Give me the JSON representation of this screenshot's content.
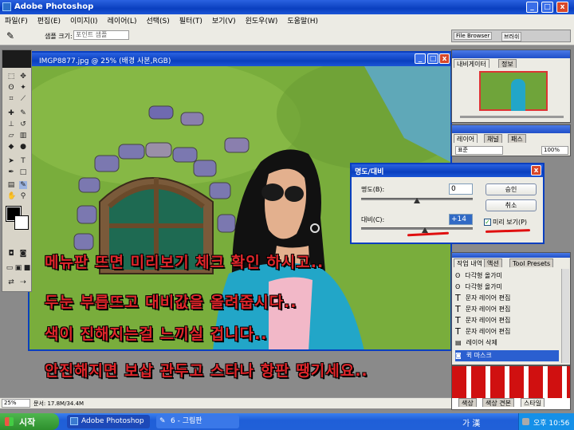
{
  "app": {
    "title": "Adobe Photoshop"
  },
  "menu": [
    "파일(F)",
    "편집(E)",
    "이미지(I)",
    "레이어(L)",
    "선택(S)",
    "필터(T)",
    "보기(V)",
    "윈도우(W)",
    "도움말(H)"
  ],
  "options_bar": {
    "label": "샘플 크기:",
    "value": "포인트 샘플"
  },
  "palette_well": {
    "tabs": [
      "File Browser",
      "브러쉬"
    ]
  },
  "document": {
    "title": "IMGP8877.jpg @ 25% (배경 사본,RGB)"
  },
  "navigator": {
    "tabs": [
      "내비게이터",
      "정보"
    ]
  },
  "layers": {
    "tabs": [
      "레이어",
      "채널",
      "패스"
    ],
    "mode": "표준",
    "opacity": "100%",
    "fill": "100%"
  },
  "history": {
    "tabs": [
      "작업 내역",
      "액션",
      "Tool Presets"
    ],
    "items": [
      "다각형 올가미",
      "다각형 올가미",
      "문자 레이어 편집",
      "문자 레이어 편집",
      "문자 레이어 편집",
      "문자 레이어 편집",
      "레이어 삭제",
      "퀵 마스크"
    ]
  },
  "bottom_tabs": [
    "색상",
    "색상 견본",
    "스타일"
  ],
  "status": {
    "zoom": "25%",
    "doc": "문서: 17.8M/34.4M"
  },
  "dialog": {
    "title": "명도/대비",
    "brightness_label": "명도(B):",
    "brightness_value": "0",
    "contrast_label": "대비(C):",
    "contrast_value": "+14",
    "ok": "승인",
    "cancel": "취소",
    "preview": "미리 보기(P)",
    "brightness_level": 0.5,
    "contrast_level": 0.57
  },
  "annotations": [
    "메뉴판 뜨면 미리보기 체크 확인 하시고..",
    "두눈 부릅뜨고 대비값을 올려줍시다..",
    "색이 진해지는걸 느끼실 겁니다..",
    "안진해지면 보삽 관두고 스타나 항판 땡기세요.."
  ],
  "taskbar": {
    "start": "시작",
    "items": [
      "Adobe Photoshop",
      "6 - 그림판"
    ],
    "lang": "가 漢",
    "clock": "오후 10:56"
  },
  "colors": {
    "accent": "#0a3fbf",
    "annotation": "#e0262b",
    "underline": "#e01010"
  }
}
